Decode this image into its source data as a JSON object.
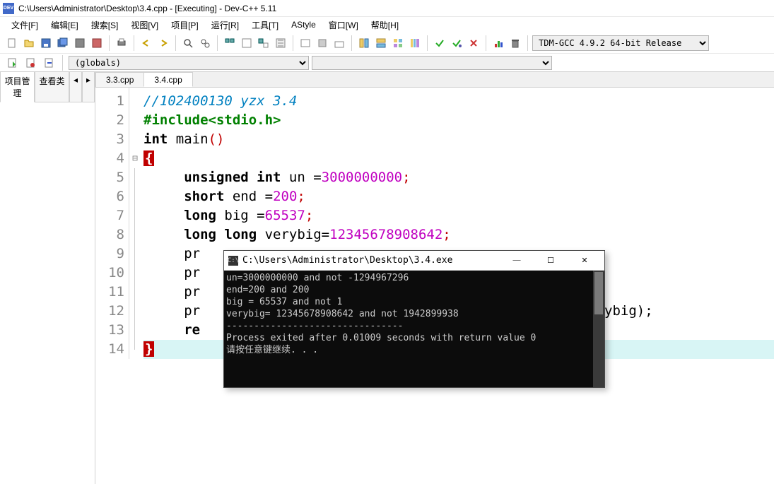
{
  "window": {
    "title": "C:\\Users\\Administrator\\Desktop\\3.4.cpp - [Executing] - Dev-C++ 5.11"
  },
  "menu": {
    "file": "文件[F]",
    "edit": "编辑[E]",
    "search": "搜索[S]",
    "view": "视图[V]",
    "project": "项目[P]",
    "run": "运行[R]",
    "tools": "工具[T]",
    "astyle": "AStyle",
    "window": "窗口[W]",
    "help": "帮助[H]"
  },
  "toolbar": {
    "compiler": "TDM-GCC 4.9.2 64-bit Release"
  },
  "scope": {
    "globals": "(globals)"
  },
  "sidebar": {
    "tab_project": "项目管理",
    "tab_classes": "查看类"
  },
  "tabs": {
    "tab1": "3.3.cpp",
    "tab2": "3.4.cpp"
  },
  "code": {
    "l1_comment": "//102400130 yzx 3.4",
    "l2_pre": "#include",
    "l2_hdr": "<stdio.h>",
    "l3_kw1": "int",
    "l3_main": " main",
    "l5_kw": "unsigned int",
    "l5_var": " un ",
    "l5_eq": "=",
    "l5_val": "3000000000",
    "l6_kw": "short",
    "l6_var": " end ",
    "l6_val": "200",
    "l7_kw": "long",
    "l7_var": " big ",
    "l7_val": "65537",
    "l8_kw": "long long",
    "l8_var": " verybig",
    "l8_val": "12345678908642",
    "l9_pr": "pr",
    "l10_pr": "pr",
    "l11_pr": "pr",
    "l12_pr": "pr",
    "l12_tail": "verybig);",
    "l13_ret": "re"
  },
  "gutter": {
    "l1": "1",
    "l2": "2",
    "l3": "3",
    "l4": "4",
    "l5": "5",
    "l6": "6",
    "l7": "7",
    "l8": "8",
    "l9": "9",
    "l10": "10",
    "l11": "11",
    "l12": "12",
    "l13": "13",
    "l14": "14"
  },
  "console": {
    "title": "C:\\Users\\Administrator\\Desktop\\3.4.exe",
    "l1": "un=3000000000 and not -1294967296",
    "l2": "end=200 and 200",
    "l3": "big = 65537 and not 1",
    "l4": "verybig= 12345678908642 and not 1942899938",
    "l5": "",
    "l6": "--------------------------------",
    "l7": "Process exited after 0.01009 seconds with return value 0",
    "l8": "请按任意键继续. . ."
  }
}
